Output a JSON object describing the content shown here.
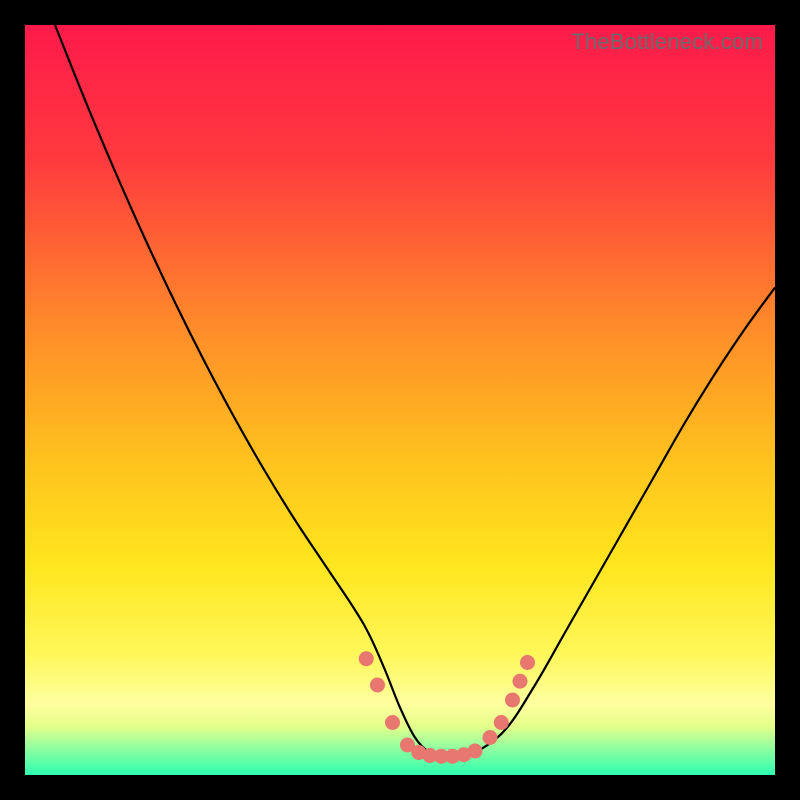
{
  "watermark": "TheBottleneck.com",
  "colors": {
    "frame": "#000000",
    "gradient_stops": [
      {
        "offset": 0.0,
        "color": "#ff1a4b"
      },
      {
        "offset": 0.18,
        "color": "#ff3a3e"
      },
      {
        "offset": 0.4,
        "color": "#ff8a2a"
      },
      {
        "offset": 0.58,
        "color": "#ffc21e"
      },
      {
        "offset": 0.72,
        "color": "#ffe61e"
      },
      {
        "offset": 0.84,
        "color": "#fff75a"
      },
      {
        "offset": 0.905,
        "color": "#ffffa0"
      },
      {
        "offset": 0.935,
        "color": "#e4ff8a"
      },
      {
        "offset": 0.965,
        "color": "#8effa0"
      },
      {
        "offset": 1.0,
        "color": "#2dffb0"
      }
    ],
    "curve": "#000000",
    "marker_fill": "#e8776f",
    "marker_stroke": "#e8776f"
  },
  "chart_data": {
    "type": "line",
    "title": "",
    "xlabel": "",
    "ylabel": "",
    "xlim": [
      0,
      100
    ],
    "ylim": [
      0,
      100
    ],
    "series": [
      {
        "name": "bottleneck-curve",
        "x": [
          4,
          8,
          12,
          16,
          20,
          24,
          28,
          32,
          36,
          40,
          44,
          46,
          48,
          50,
          52,
          54,
          56,
          58,
          60,
          64,
          68,
          72,
          76,
          80,
          84,
          88,
          92,
          96,
          100
        ],
        "y": [
          100,
          90,
          80.5,
          71.5,
          63,
          55,
          47.5,
          40.5,
          34,
          28,
          22,
          18.5,
          14,
          9,
          5,
          3,
          2.5,
          2.5,
          3,
          6,
          12,
          19,
          26,
          33,
          40,
          47,
          53.5,
          59.5,
          65
        ]
      }
    ],
    "markers": {
      "name": "highlight-band",
      "points": [
        {
          "x": 45.5,
          "y": 15.5
        },
        {
          "x": 47.0,
          "y": 12.0
        },
        {
          "x": 49.0,
          "y": 7.0
        },
        {
          "x": 51.0,
          "y": 4.0
        },
        {
          "x": 52.5,
          "y": 3.0
        },
        {
          "x": 54.0,
          "y": 2.6
        },
        {
          "x": 55.5,
          "y": 2.5
        },
        {
          "x": 57.0,
          "y": 2.5
        },
        {
          "x": 58.5,
          "y": 2.7
        },
        {
          "x": 60.0,
          "y": 3.2
        },
        {
          "x": 62.0,
          "y": 5.0
        },
        {
          "x": 63.5,
          "y": 7.0
        },
        {
          "x": 65.0,
          "y": 10.0
        },
        {
          "x": 66.0,
          "y": 12.5
        },
        {
          "x": 67.0,
          "y": 15.0
        }
      ]
    }
  }
}
